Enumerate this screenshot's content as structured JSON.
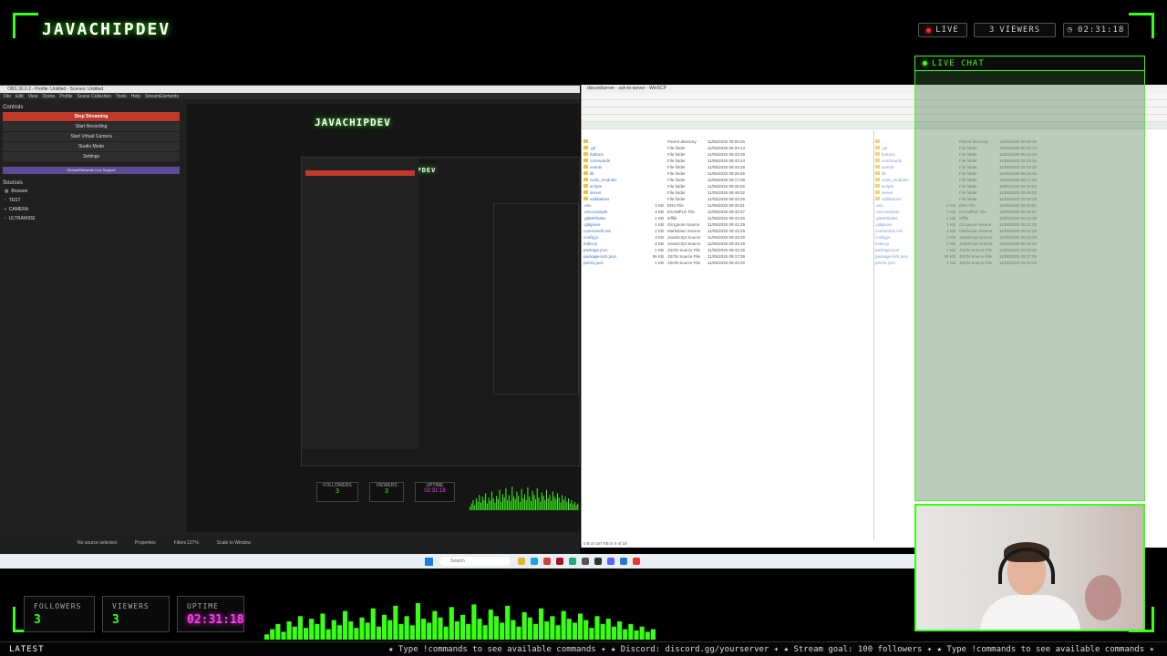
{
  "brand": "JAVACHIPDEV",
  "header": {
    "live": "LIVE",
    "viewers_count": "3",
    "viewers_label": "VIEWERS",
    "uptime": "02:31:18"
  },
  "chat": {
    "title": "LIVE CHAT"
  },
  "obs": {
    "title": "OBS 30.0.2 - Profile: Untitled - Scenes: Untitled",
    "menu": [
      "File",
      "Edit",
      "View",
      "Docks",
      "Profile",
      "Scene Collection",
      "Tools",
      "Help",
      "StreamElements"
    ],
    "controls_title": "Controls",
    "controls": [
      "Stop Streaming",
      "Start Recording",
      "Start Virtual Camera",
      "Studio Mode",
      "Settings"
    ],
    "status_strip": "StreamElements Live Support",
    "sources_title": "Sources",
    "sources": [
      "Browser",
      "TEST",
      "CAMERA",
      "ULTRAWIDE"
    ],
    "zoom": "127%",
    "scale": "Scale to Window",
    "no_source": "No source selected",
    "properties": "Properties",
    "filters": "Filters"
  },
  "winscp": {
    "title": "discordserver - ssh-to-server - WinSCP",
    "left_rows": [
      {
        "n": "..",
        "s": "",
        "t": "Parent directory",
        "d": "11/05/2025 09:00:26"
      },
      {
        "n": ".git",
        "s": "",
        "t": "File folder",
        "d": "11/05/2025 09:20:13"
      },
      {
        "n": "buttons",
        "s": "",
        "t": "File folder",
        "d": "11/05/2025 09:43:29"
      },
      {
        "n": "commands",
        "s": "",
        "t": "File folder",
        "d": "11/05/2025 09:43:24"
      },
      {
        "n": "events",
        "s": "",
        "t": "File folder",
        "d": "11/05/2025 09:43:29"
      },
      {
        "n": "lib",
        "s": "",
        "t": "File folder",
        "d": "11/05/2025 09:26:46"
      },
      {
        "n": "node_modules",
        "s": "",
        "t": "File folder",
        "d": "11/05/2025 09:17:09"
      },
      {
        "n": "scripts",
        "s": "",
        "t": "File folder",
        "d": "11/05/2025 09:46:02"
      },
      {
        "n": "server",
        "s": "",
        "t": "File folder",
        "d": "11/05/2025 09:46:02"
      },
      {
        "n": "validations",
        "s": "",
        "t": "File folder",
        "d": "11/05/2025 09:43:29"
      },
      {
        "n": ".env",
        "s": "2 KB",
        "t": "ENV File",
        "d": "11/05/2025 09:30:51"
      },
      {
        "n": ".env.example",
        "s": "4 KB",
        "t": "EXAMPLE File",
        "d": "11/05/2025 09:40:27"
      },
      {
        "n": ".gitattributes",
        "s": "1 KB",
        "t": "ieffile",
        "d": "11/05/2025 09:43:29"
      },
      {
        "n": ".gitignore",
        "s": "1 KB",
        "t": "Git Ignore Source",
        "d": "11/05/2025 09:41:29"
      },
      {
        "n": "commands.md",
        "s": "2 KB",
        "t": "Markdown Source",
        "d": "11/05/2025 09:43:29"
      },
      {
        "n": "config.js",
        "s": "3 KB",
        "t": "JavaScript Source",
        "d": "11/05/2025 09:43:29"
      },
      {
        "n": "index.js",
        "s": "2 KB",
        "t": "JavaScript Source",
        "d": "11/05/2025 09:42:29"
      },
      {
        "n": "package.json",
        "s": "1 KB",
        "t": "JSON Source File",
        "d": "11/05/2025 09:43:29"
      },
      {
        "n": "package-lock.json",
        "s": "95 KB",
        "t": "JSON Source File",
        "d": "11/05/2025 09:17:09"
      },
      {
        "n": "perms.json",
        "s": "1 KB",
        "t": "JSON Source File",
        "d": "11/05/2025 09:43:29"
      }
    ],
    "status": "0 B of 167 KB in 0 of 19"
  },
  "taskbar": {
    "search": "Search"
  },
  "stats": [
    {
      "label": "FOLLOWERS",
      "value": "3"
    },
    {
      "label": "VIEWERS",
      "value": "3"
    },
    {
      "label": "UPTIME",
      "value": "02:31:18"
    }
  ],
  "ticker": {
    "latest": "LATEST",
    "text": "★ Type !commands to see available commands ✦ ★ Discord: discord.gg/yourserver ✦ ★ Stream goal: 100 followers ✦ ★ Type !commands to see available commands ✦"
  },
  "visualizer": [
    4,
    8,
    12,
    6,
    14,
    10,
    18,
    9,
    16,
    12,
    20,
    8,
    15,
    11,
    22,
    14,
    9,
    17,
    13,
    24,
    10,
    19,
    15,
    26,
    12,
    18,
    11,
    28,
    16,
    13,
    22,
    17,
    10,
    25,
    14,
    19,
    12,
    27,
    16,
    11,
    23,
    18,
    13,
    26,
    15,
    10,
    21,
    17,
    12,
    24,
    14,
    18,
    11,
    22,
    16,
    13,
    20,
    15,
    9,
    18,
    12,
    16,
    10,
    14,
    8,
    12,
    7,
    10,
    6,
    8
  ]
}
